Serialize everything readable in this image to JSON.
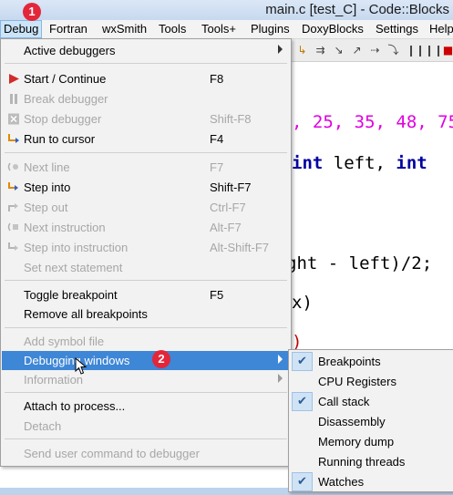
{
  "window": {
    "title": "main.c [test_C] - Code::Blocks"
  },
  "menubar": {
    "items": [
      {
        "label": "Debug"
      },
      {
        "label": "Fortran"
      },
      {
        "label": "wxSmith"
      },
      {
        "label": "Tools"
      },
      {
        "label": "Tools+"
      },
      {
        "label": "Plugins"
      },
      {
        "label": "DoxyBlocks"
      },
      {
        "label": "Settings"
      },
      {
        "label": "Help"
      }
    ]
  },
  "badges": {
    "one": "1",
    "two": "2"
  },
  "debug_menu": {
    "active_debuggers": "Active debuggers",
    "start_continue": {
      "label": "Start / Continue",
      "shortcut": "F8"
    },
    "break_debugger": {
      "label": "Break debugger"
    },
    "stop_debugger": {
      "label": "Stop debugger",
      "shortcut": "Shift-F8"
    },
    "run_to_cursor": {
      "label": "Run to cursor",
      "shortcut": "F4"
    },
    "next_line": {
      "label": "Next line",
      "shortcut": "F7"
    },
    "step_into": {
      "label": "Step into",
      "shortcut": "Shift-F7"
    },
    "step_out": {
      "label": "Step out",
      "shortcut": "Ctrl-F7"
    },
    "next_instruction": {
      "label": "Next instruction",
      "shortcut": "Alt-F7"
    },
    "step_into_instruction": {
      "label": "Step into instruction",
      "shortcut": "Alt-Shift-F7"
    },
    "set_next_statement": {
      "label": "Set next statement"
    },
    "toggle_breakpoint": {
      "label": "Toggle breakpoint",
      "shortcut": "F5"
    },
    "remove_all_breakpoints": {
      "label": "Remove all breakpoints"
    },
    "add_symbol_file": {
      "label": "Add symbol file"
    },
    "debugging_windows": {
      "label": "Debugging windows"
    },
    "information": {
      "label": "Information"
    },
    "attach_to_process": {
      "label": "Attach to process..."
    },
    "detach": {
      "label": "Detach"
    },
    "send_user_command": {
      "label": "Send user command to debugger"
    }
  },
  "submenu": {
    "items": [
      {
        "label": "Breakpoints",
        "checked": true
      },
      {
        "label": "CPU Registers",
        "checked": false
      },
      {
        "label": "Call stack",
        "checked": true
      },
      {
        "label": "Disassembly",
        "checked": false
      },
      {
        "label": "Memory dump",
        "checked": false
      },
      {
        "label": "Running threads",
        "checked": false
      },
      {
        "label": "Watches",
        "checked": true
      }
    ],
    "check_glyph": "✔"
  },
  "editor": {
    "line1": ", 25, 35, 48, 75",
    "line2_kw1": "int",
    "line2_id1": " left, ",
    "line2_kw2": "int",
    "line3": "ght - left)/2;",
    "line4": "x)",
    "line5": ")"
  },
  "colors": {
    "highlight": "#3e86d6",
    "badge": "#e3263a",
    "keyword": "#0000a0",
    "number": "#e000e0"
  }
}
